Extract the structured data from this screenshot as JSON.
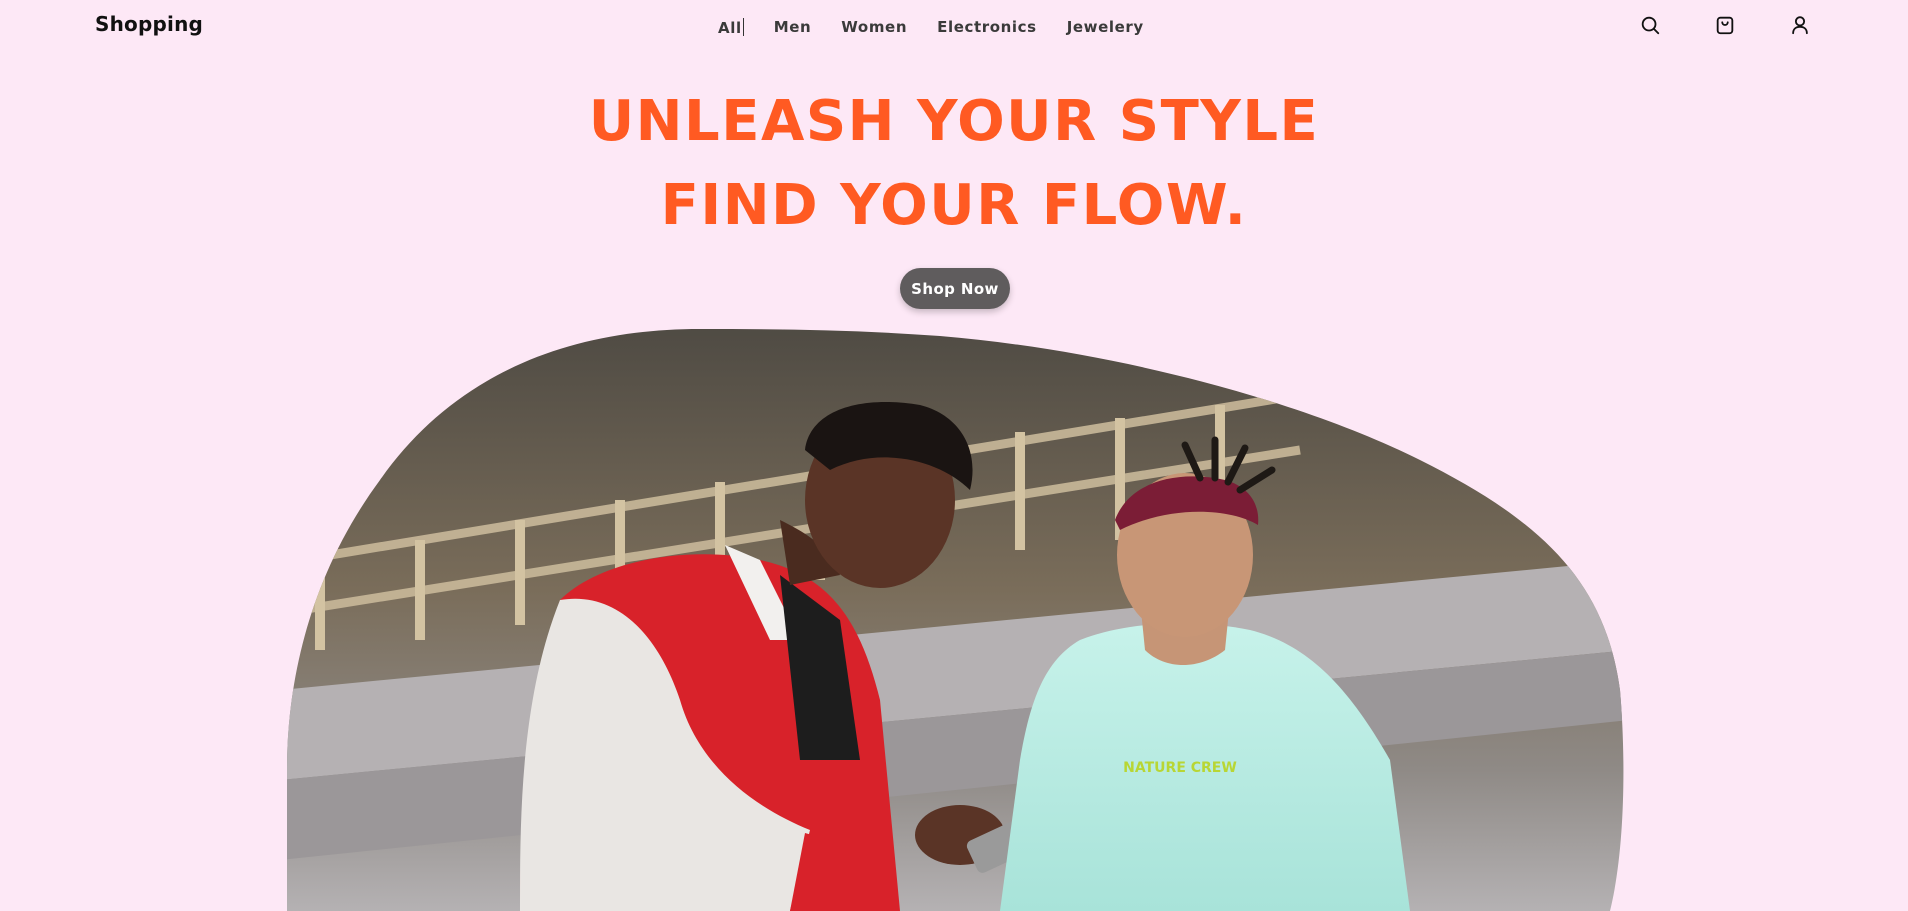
{
  "header": {
    "brand": "Shopping",
    "nav": [
      {
        "label": "All"
      },
      {
        "label": "Men"
      },
      {
        "label": "Women"
      },
      {
        "label": "Electronics"
      },
      {
        "label": "Jewelery"
      }
    ],
    "icons": [
      "search-icon",
      "shopping-bag-icon",
      "user-icon"
    ]
  },
  "hero": {
    "line1": "UNLEASH YOUR STYLE",
    "line2": "FIND YOUR FLOW.",
    "cta_label": "Shop Now",
    "image_shirt_text": "NATURE CREW"
  },
  "colors": {
    "background": "#fde8f6",
    "accent": "#ff5a22",
    "cta": "#5f5c5d"
  }
}
